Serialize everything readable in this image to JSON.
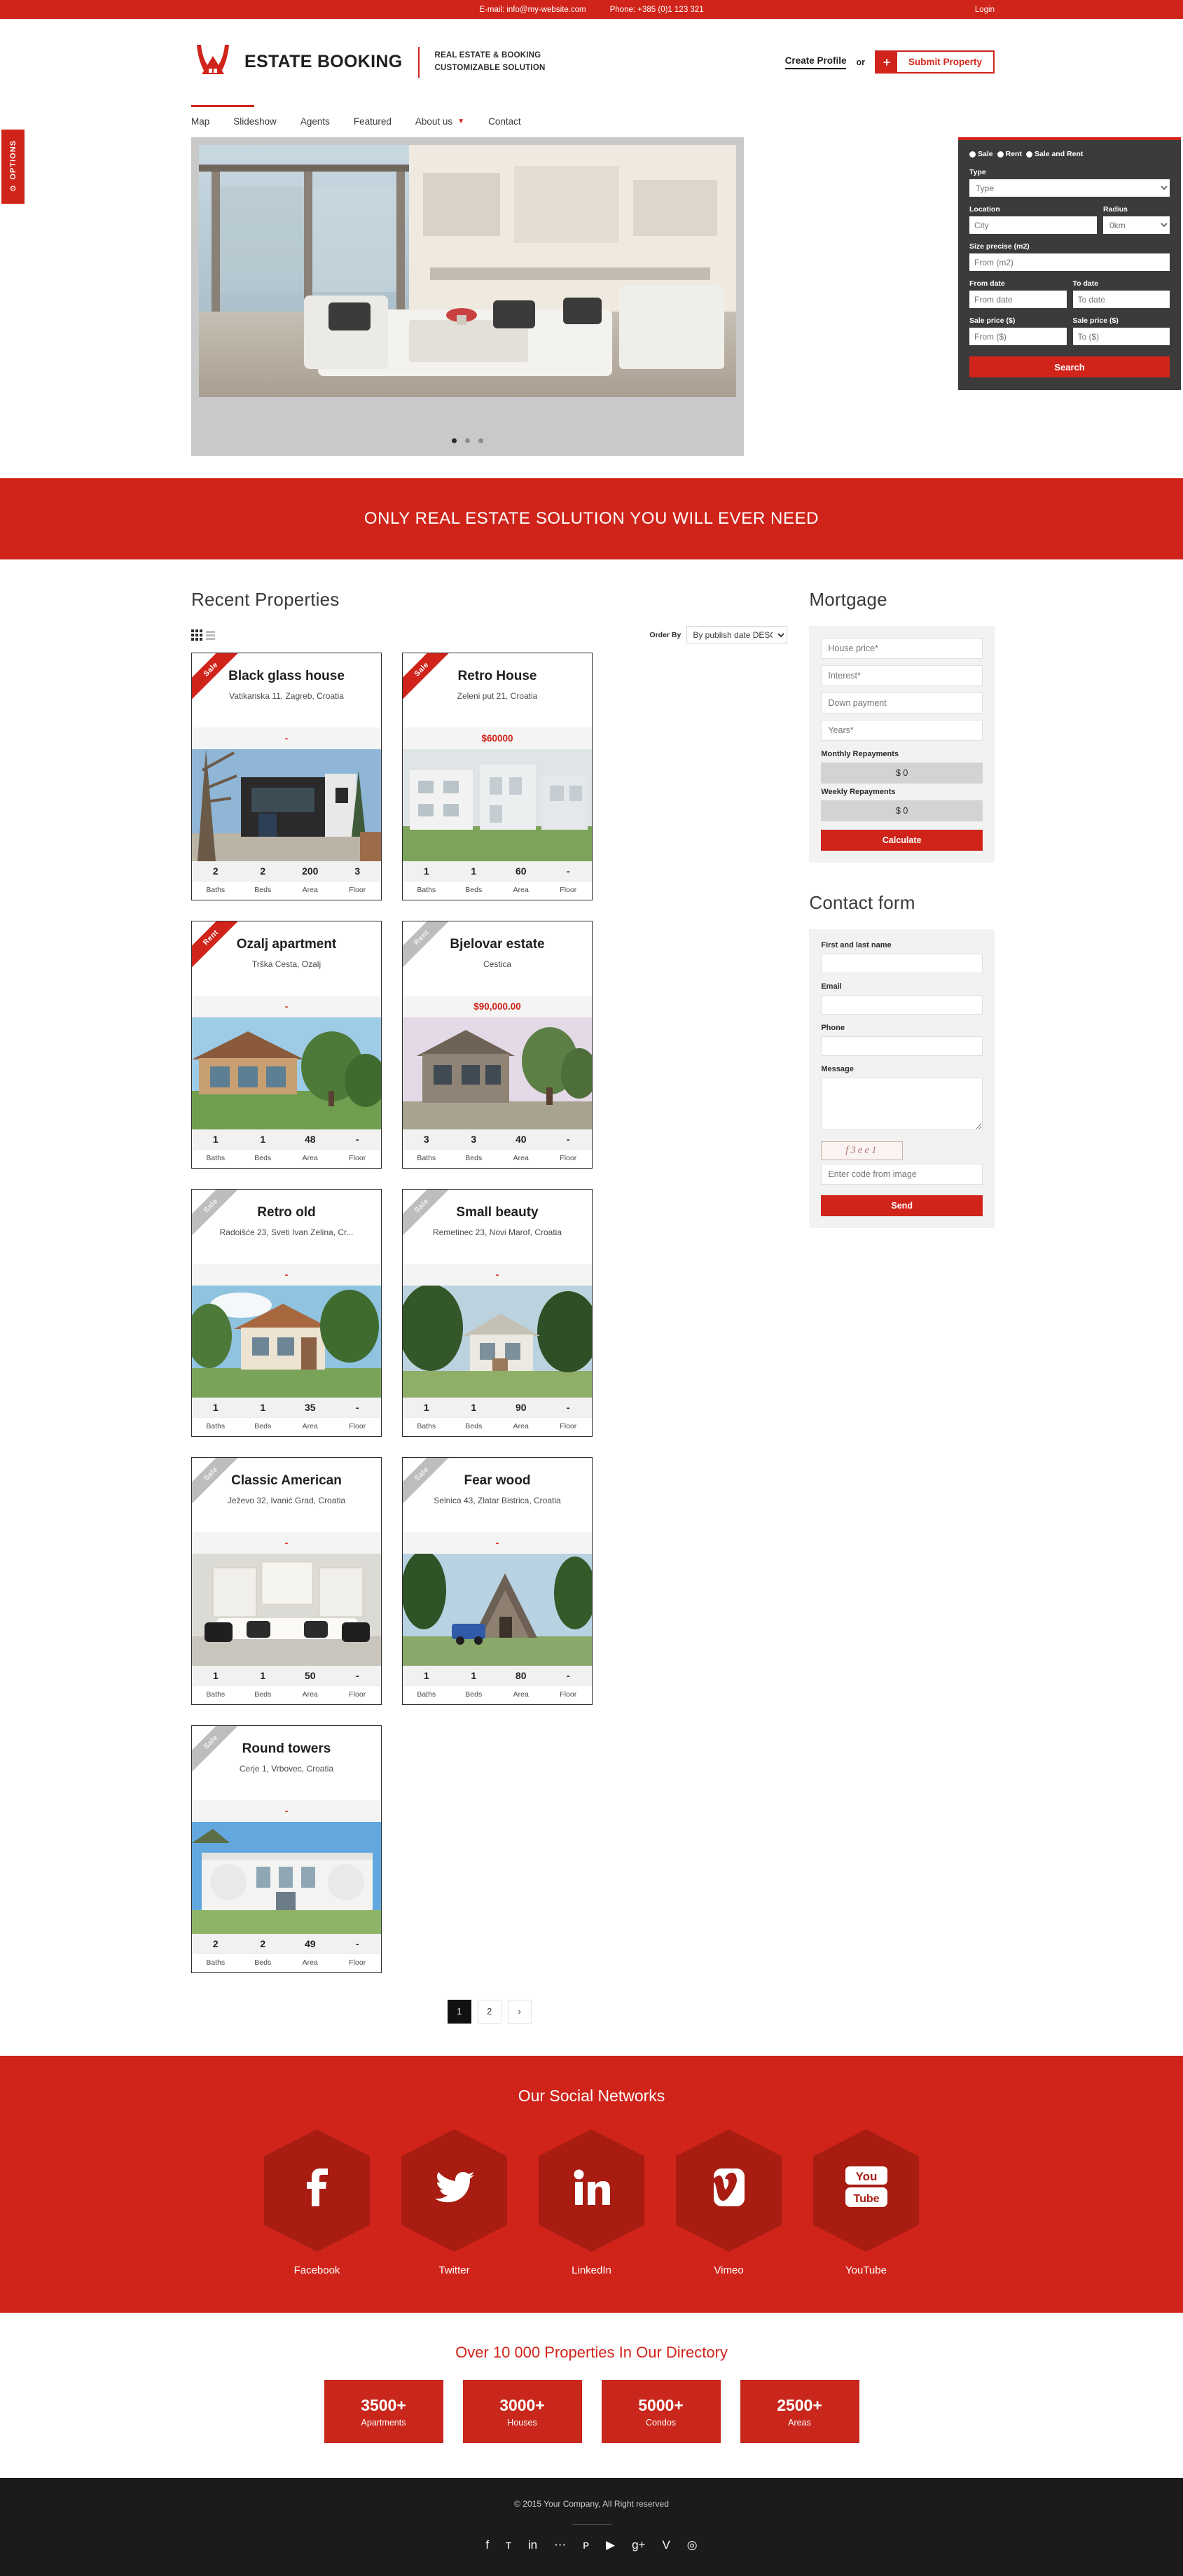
{
  "topbar": {
    "email": "E-mail: info@my-website.com",
    "phone": "Phone: +385 (0)1 123 321",
    "login": "Login"
  },
  "header": {
    "brand": "ESTATE BOOKING",
    "tagline_line1": "REAL ESTATE & BOOKING",
    "tagline_line2": "CUSTOMIZABLE SOLUTION",
    "create_profile": "Create Profile",
    "or": "or",
    "submit_plus": "+",
    "submit_property": "Submit Property"
  },
  "options_tab": {
    "label": "OPTIONS",
    "gear": "⚙"
  },
  "nav": {
    "items": [
      {
        "label": "Map",
        "has_caret": false
      },
      {
        "label": "Slideshow",
        "has_caret": false
      },
      {
        "label": "Agents",
        "has_caret": false
      },
      {
        "label": "Featured",
        "has_caret": false
      },
      {
        "label": "About us",
        "has_caret": true
      },
      {
        "label": "Contact",
        "has_caret": false
      }
    ]
  },
  "search": {
    "modes": [
      "Sale",
      "Rent",
      "Sale and Rent"
    ],
    "type_label": "Type",
    "type_value": "Type",
    "location_label": "Location",
    "location_placeholder": "City",
    "radius_label": "Radius",
    "radius_value": "0km",
    "size_label": "Size precise (m2)",
    "size_placeholder": "From (m2)",
    "from_date_label": "From date",
    "from_date_placeholder": "From date",
    "to_date_label": "To date",
    "to_date_placeholder": "To date",
    "price_from_label": "Sale price ($)",
    "price_from_placeholder": "From ($)",
    "price_to_label": "Sale price ($)",
    "price_to_placeholder": "To ($)",
    "button": "Search"
  },
  "banner": {
    "text": "ONLY REAL ESTATE SOLUTION YOU WILL EVER NEED"
  },
  "properties": {
    "title": "Recent Properties",
    "order_by_label": "Order By",
    "order_by_value": "By publish date DESC",
    "stat_labels": [
      "Baths",
      "Beds",
      "Area",
      "Floor"
    ],
    "items": [
      {
        "ribbon": "Sale",
        "ribbon_style": "sale",
        "title": "Black glass house",
        "address": "Vatikanska 11, Zagreb, Croatia",
        "price": "-",
        "baths": "2",
        "beds": "2",
        "area": "200",
        "floor": "3",
        "photo": "black-glass-house"
      },
      {
        "ribbon": "Sale",
        "ribbon_style": "sale",
        "title": "Retro House",
        "address": "Zeleni put 21, Croatia",
        "price": "$60000",
        "baths": "1",
        "beds": "1",
        "area": "60",
        "floor": "-",
        "photo": "retro-house"
      },
      {
        "ribbon": "Rent",
        "ribbon_style": "rent",
        "title": "Ozalj apartment",
        "address": "Trška Cesta, Ozalj",
        "price": "-",
        "baths": "1",
        "beds": "1",
        "area": "48",
        "floor": "-",
        "photo": "ozalj-apartment"
      },
      {
        "ribbon": "Rent",
        "ribbon_style": "muted",
        "title": "Bjelovar estate",
        "address": "Cestica",
        "price": "$90,000.00",
        "baths": "3",
        "beds": "3",
        "area": "40",
        "floor": "-",
        "photo": "bjelovar-estate"
      },
      {
        "ribbon": "Sale",
        "ribbon_style": "muted",
        "title": "Retro old",
        "address": "Radoišće 23, Sveti Ivan Zelina, Cr...",
        "price": "-",
        "baths": "1",
        "beds": "1",
        "area": "35",
        "floor": "-",
        "photo": "retro-old"
      },
      {
        "ribbon": "Sale",
        "ribbon_style": "muted",
        "title": "Small beauty",
        "address": "Remetinec 23, Novi Marof, Croatia",
        "price": "-",
        "baths": "1",
        "beds": "1",
        "area": "90",
        "floor": "-",
        "photo": "small-beauty"
      },
      {
        "ribbon": "Sale",
        "ribbon_style": "muted",
        "title": "Classic American",
        "address": "Ježevo 32, Ivanić Grad, Croatia",
        "price": "-",
        "baths": "1",
        "beds": "1",
        "area": "50",
        "floor": "-",
        "photo": "classic-american"
      },
      {
        "ribbon": "Sale",
        "ribbon_style": "muted",
        "title": "Fear wood",
        "address": "Selnica 43, Zlatar Bistrica, Croatia",
        "price": "-",
        "baths": "1",
        "beds": "1",
        "area": "80",
        "floor": "-",
        "photo": "fear-wood"
      },
      {
        "ribbon": "Sale",
        "ribbon_style": "muted",
        "title": "Round towers",
        "address": "Cerje 1, Vrbovec, Croatia",
        "price": "-",
        "baths": "2",
        "beds": "2",
        "area": "49",
        "floor": "-",
        "photo": "round-towers"
      }
    ],
    "pagination": {
      "pages": [
        "1",
        "2"
      ],
      "next": "›",
      "active": "1"
    }
  },
  "mortgage": {
    "title": "Mortgage",
    "house_price_placeholder": "House price*",
    "interest_placeholder": "Interest*",
    "down_payment_placeholder": "Down payment",
    "years_placeholder": "Years*",
    "monthly_label": "Monthly Repayments",
    "monthly_value": "$ 0",
    "weekly_label": "Weekly Repayments",
    "weekly_value": "$ 0",
    "button": "Calculate"
  },
  "contact_form": {
    "title": "Contact form",
    "name_label": "First and last name",
    "email_label": "Email",
    "phone_label": "Phone",
    "message_label": "Message",
    "captcha_code": "f3ee1",
    "captcha_placeholder": "Enter code from image",
    "button": "Send"
  },
  "social": {
    "title": "Our Social Networks",
    "items": [
      {
        "name": "Facebook",
        "glyph": "f"
      },
      {
        "name": "Twitter",
        "glyph": "ᴛ"
      },
      {
        "name": "LinkedIn",
        "glyph": "in"
      },
      {
        "name": "Vimeo",
        "glyph": "V"
      },
      {
        "name": "YouTube",
        "glyph": "▶"
      }
    ]
  },
  "directory": {
    "title": "Over 10 000 Properties In Our Directory",
    "stats": [
      {
        "number": "3500+",
        "caption": "Apartments"
      },
      {
        "number": "3000+",
        "caption": "Houses"
      },
      {
        "number": "5000+",
        "caption": "Condos"
      },
      {
        "number": "2500+",
        "caption": "Areas"
      }
    ]
  },
  "footer": {
    "copyright": "© 2015 Your Company, All Right reserved",
    "icons": [
      "facebook-icon",
      "twitter-icon",
      "linkedin-icon",
      "flickr-icon",
      "pinterest-icon",
      "youtube-icon",
      "google-plus-icon",
      "vimeo-icon",
      "dribbble-icon"
    ],
    "glyphs": [
      "f",
      "ᴛ",
      "in",
      "⋯",
      "ᴘ",
      "▶",
      "g+",
      "V",
      "◎"
    ]
  }
}
